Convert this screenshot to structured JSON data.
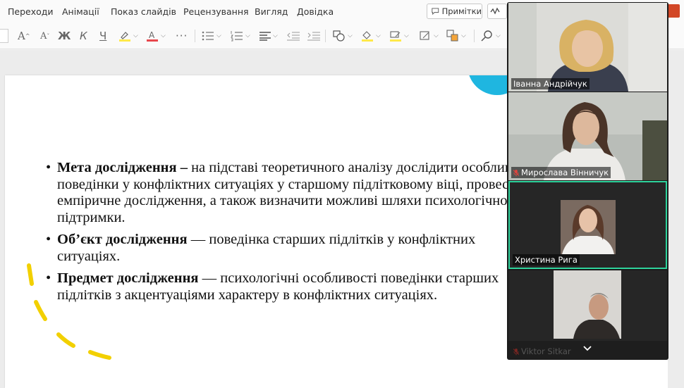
{
  "ribbon": {
    "tabs": [
      "Переходи",
      "Анімації",
      "Показ слайдів",
      "Рецензування",
      "Вигляд",
      "Довідка"
    ],
    "notes_label": "Примітки"
  },
  "toolbar": {
    "grow_font": "A",
    "shrink_font": "A",
    "bold": "Ж",
    "italic": "К",
    "underline": "Ч",
    "more": "···"
  },
  "slide": {
    "bullets": [
      {
        "bold": "Мета дослідження –",
        "text": " на підставі теоретичного аналізу дослідити особливості поведінки у конфліктних ситуаціях у старшому підлітковому віці, провести емпіричне дослідження, а також визначити можливі шляхи психологічної підтримки."
      },
      {
        "bold": "Об’єкт дослідження",
        "text": " — поведінка старших підлітків у конфліктних ситуаціях."
      },
      {
        "bold": "Предмет дослідження",
        "text": " — психологічні особливості поведінки старших підлітків з акцентуаціями характеру в конфліктних ситуаціях."
      }
    ],
    "colors": {
      "accent_circle": "#1fb6e0",
      "dashes": "#f2d000"
    }
  },
  "video": {
    "participants": [
      {
        "name": "Іванна Андрійчук",
        "muted": false,
        "active": false
      },
      {
        "name": "Мирослава Вінничук",
        "muted": true,
        "active": false
      },
      {
        "name": "Христина Рига",
        "muted": false,
        "active": true
      },
      {
        "name": "Viktor Sitkar",
        "muted": true,
        "active": false
      }
    ],
    "active_border": "#2ed39c"
  }
}
